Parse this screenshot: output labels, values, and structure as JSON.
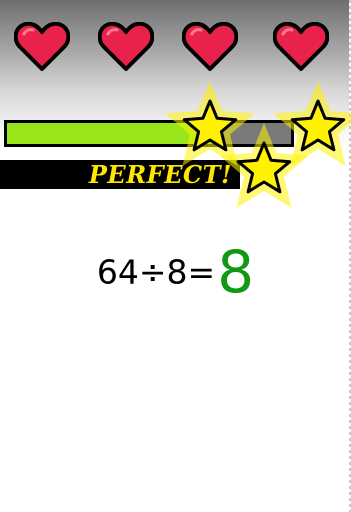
{
  "hud": {
    "hearts": [
      {
        "icon": "heart-icon",
        "color": "#e8224a"
      },
      {
        "icon": "heart-icon",
        "color": "#e8224a"
      },
      {
        "icon": "heart-icon",
        "color": "#e8224a"
      },
      {
        "icon": "heart-icon",
        "color": "#e8224a"
      }
    ],
    "progress": {
      "fraction": 0.72,
      "fill_color": "#99e61a"
    },
    "feedback": "PERFECT!",
    "feedback_color": "#ffe600",
    "stars": [
      {
        "icon": "star-icon",
        "color": "#fff200"
      },
      {
        "icon": "star-icon",
        "color": "#fff200"
      },
      {
        "icon": "star-icon",
        "color": "#fff200"
      }
    ]
  },
  "equation": {
    "expression": "64÷8=",
    "answer": "8",
    "answer_color": "#119911"
  }
}
